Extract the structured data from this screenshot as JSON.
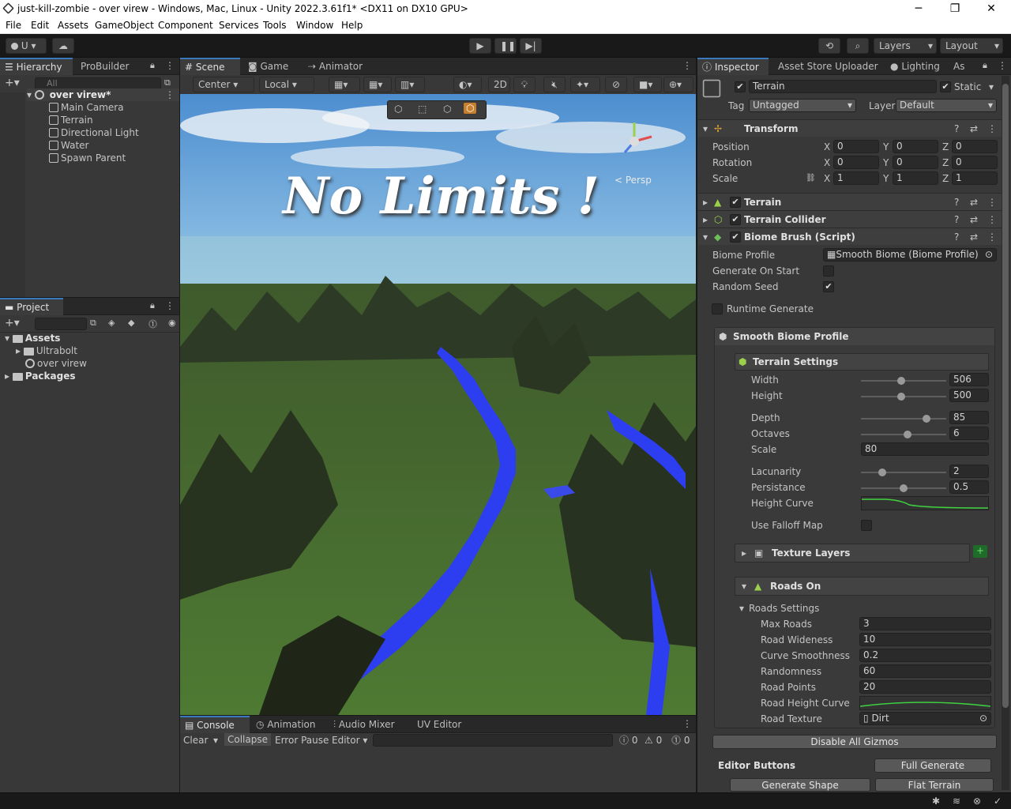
{
  "window": {
    "title": "just-kill-zombie - over virew - Windows, Mac, Linux - Unity 2022.3.61f1* <DX11 on DX10 GPU>",
    "minimize": "─",
    "maximize": "❐",
    "close": "✕"
  },
  "menu": [
    "File",
    "Edit",
    "Assets",
    "GameObject",
    "Component",
    "Services",
    "Tools",
    "Window",
    "Help"
  ],
  "toolbar": {
    "account": "U",
    "layers": "Layers",
    "layout": "Layout"
  },
  "hierarchy": {
    "tabs": [
      "Hierarchy",
      "ProBuilder"
    ],
    "search_placeholder": "All",
    "scene": "over virew*",
    "items": [
      "Main Camera",
      "Terrain",
      "Directional Light",
      "Water",
      "Spawn Parent"
    ]
  },
  "project": {
    "tab": "Project",
    "root": "Assets",
    "children": [
      "Ultrabolt",
      "over virew"
    ],
    "packages": "Packages"
  },
  "scene_view": {
    "tabs": [
      "Scene",
      "Game",
      "Animator"
    ],
    "pivot": "Center",
    "space": "Local",
    "mode_2d": "2D",
    "persp": "< Persp",
    "overlay_text": "No Limits !"
  },
  "console": {
    "tabs": [
      "Console",
      "Animation",
      "Audio Mixer",
      "UV Editor"
    ],
    "clear": "Clear",
    "collapse": "Collapse",
    "error_pause": "Error Pause",
    "editor": "Editor",
    "counts": [
      "0",
      "0",
      "0"
    ]
  },
  "inspector": {
    "tabs": [
      "Inspector",
      "Asset Store Uploader",
      "Lighting",
      "As"
    ],
    "object_name": "Terrain",
    "static": "Static",
    "tag_label": "Tag",
    "tag": "Untagged",
    "layer_label": "Layer",
    "layer": "Default",
    "transform": {
      "title": "Transform",
      "position": [
        "0",
        "0",
        "0"
      ],
      "rotation": [
        "0",
        "0",
        "0"
      ],
      "scale": [
        "1",
        "1",
        "1"
      ],
      "labels": [
        "Position",
        "Rotation",
        "Scale"
      ],
      "axes": [
        "X",
        "Y",
        "Z"
      ]
    },
    "components": [
      "Terrain",
      "Terrain Collider",
      "Biome Brush (Script)"
    ],
    "biome": {
      "profile_label": "Biome Profile",
      "profile": "Smooth Biome (Biome Profile)",
      "generate_on_start": "Generate On Start",
      "random_seed": "Random Seed",
      "runtime_generate": "Runtime Generate"
    },
    "profile_section": "Smooth Biome Profile",
    "terrain_settings": {
      "title": "Terrain Settings",
      "sliders": [
        {
          "label": "Width",
          "value": "506",
          "fraction": 0.47
        },
        {
          "label": "Height",
          "value": "500",
          "fraction": 0.47
        },
        {
          "label": "Depth",
          "value": "85",
          "fraction": 0.8
        },
        {
          "label": "Octaves",
          "value": "6",
          "fraction": 0.55
        }
      ],
      "scale_label": "Scale",
      "scale": "80",
      "sliders2": [
        {
          "label": "Lacunarity",
          "value": "2",
          "fraction": 0.22
        },
        {
          "label": "Persistance",
          "value": "0.5",
          "fraction": 0.5
        }
      ],
      "height_curve": "Height Curve",
      "use_falloff": "Use Falloff Map"
    },
    "texture_layers": "Texture Layers",
    "roads_on": "Roads On",
    "roads": {
      "title": "Roads Settings",
      "fields": [
        {
          "label": "Max Roads",
          "value": "3"
        },
        {
          "label": "Road Wideness",
          "value": "10"
        },
        {
          "label": "Curve Smoothness",
          "value": "0.2"
        },
        {
          "label": "Randomness",
          "value": "60"
        },
        {
          "label": "Road Points",
          "value": "20"
        }
      ],
      "height_curve": "Road Height Curve",
      "texture_label": "Road Texture",
      "texture": "Dirt"
    },
    "disable_gizmos": "Disable All Gizmos",
    "editor_buttons": "Editor Buttons",
    "full_generate": "Full Generate",
    "generate_shape": "Generate Shape",
    "flat_terrain": "Flat Terrain"
  }
}
